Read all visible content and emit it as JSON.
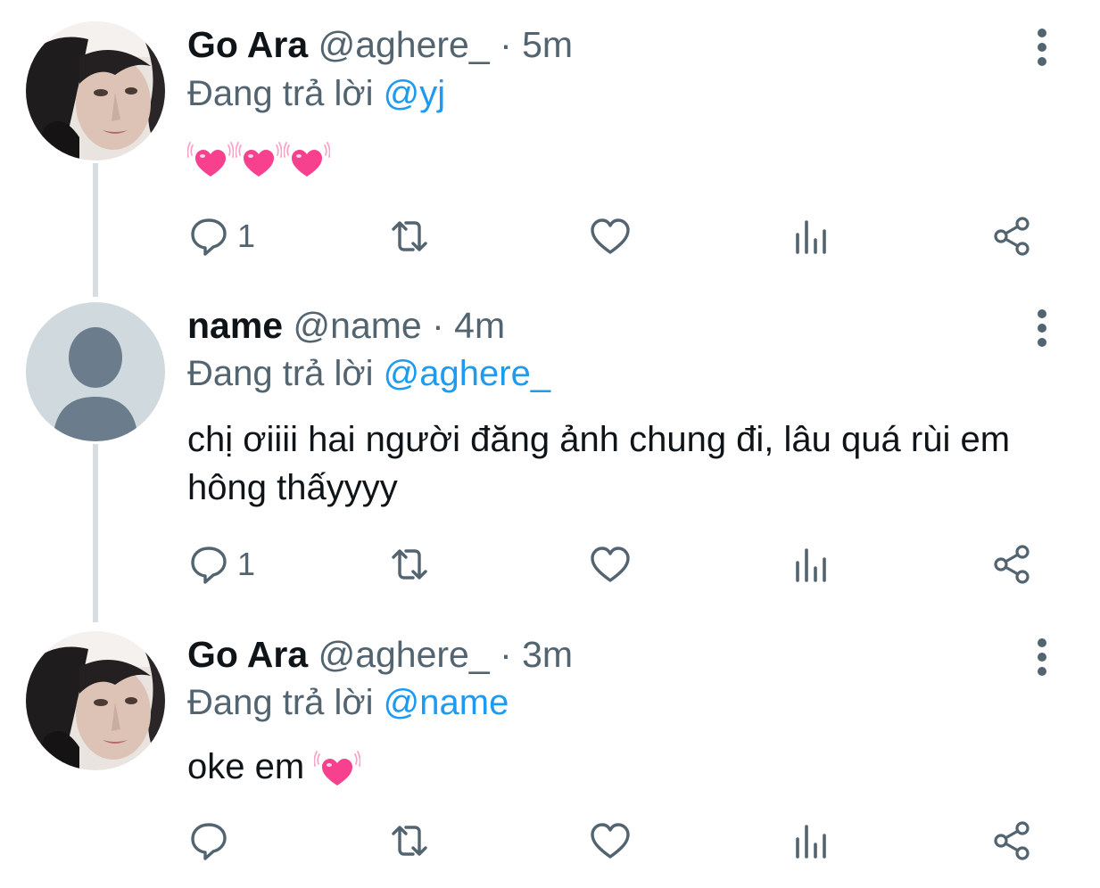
{
  "colors": {
    "text_primary": "#0f1419",
    "text_secondary": "#536471",
    "mention": "#1d9bf0",
    "thread_line": "#d8dde2",
    "icon": "#536471",
    "heart_emoji": "#f7418f"
  },
  "icons": {
    "reply": "speech-bubble-icon",
    "retweet": "retweet-arrows-icon",
    "like": "heart-outline-icon",
    "views": "bar-chart-icon",
    "share": "share-nodes-icon",
    "more": "vertical-ellipsis-icon",
    "emoji": "growing-heart-emoji"
  },
  "tweets": [
    {
      "display_name": "Go Ara",
      "handle": "@aghere_",
      "separator": " · ",
      "time": "5m",
      "reply_prefix": "Đang trả lời ",
      "reply_to": "@yj",
      "text": "",
      "emoji_count": 3,
      "reply_count": "1",
      "avatar": "photo"
    },
    {
      "display_name": "name",
      "handle": "@name",
      "separator": " · ",
      "time": "4m",
      "reply_prefix": "Đang trả lời ",
      "reply_to": "@aghere_",
      "text": "chị ơiiii hai người đăng ảnh chung đi, lâu quá rùi em hông thấyyyy",
      "emoji_count": 0,
      "reply_count": "1",
      "avatar": "default"
    },
    {
      "display_name": "Go Ara",
      "handle": "@aghere_",
      "separator": " · ",
      "time": "3m",
      "reply_prefix": "Đang trả lời ",
      "reply_to": "@name",
      "text": "oke em",
      "emoji_count": 1,
      "reply_count": "",
      "avatar": "photo"
    }
  ]
}
